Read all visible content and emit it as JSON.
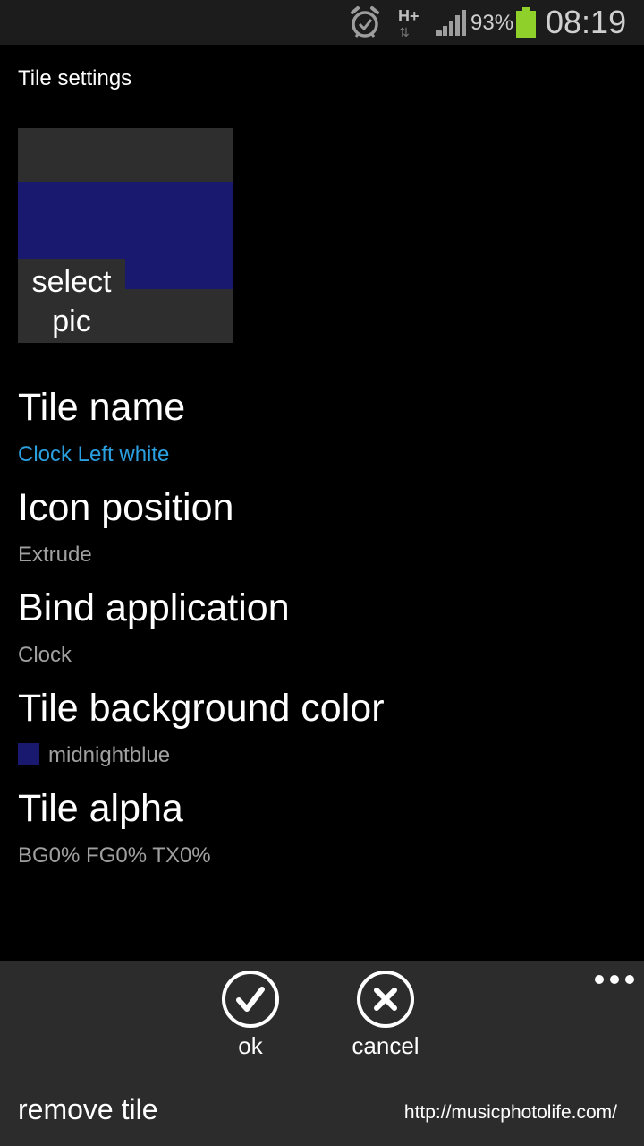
{
  "status_bar": {
    "network_type": "H+",
    "network_arrows": "⇅",
    "battery_percent": "93%",
    "time": "08:19"
  },
  "page": {
    "title": "Tile settings"
  },
  "picture": {
    "select_label_line1": "select",
    "select_label_line2": "pic",
    "band_color": "#191970"
  },
  "settings": {
    "tile_name": {
      "title": "Tile name",
      "value": "Clock Left white"
    },
    "icon_position": {
      "title": "Icon position",
      "value": "Extrude"
    },
    "bind_application": {
      "title": "Bind application",
      "value": "Clock"
    },
    "background_color": {
      "title": "Tile background color",
      "value": "midnightblue",
      "swatch": "#191970"
    },
    "tile_alpha": {
      "title": "Tile alpha",
      "value": "BG0% FG0% TX0%"
    }
  },
  "app_bar": {
    "ok_label": "ok",
    "cancel_label": "cancel",
    "remove_tile_label": "remove tile",
    "watermark": "http://musicphotolife.com/"
  },
  "colors": {
    "accent": "#2aa0e0",
    "battery": "#8fd12a",
    "app_bar": "#2c2c2c"
  },
  "icons": [
    "alarm-icon",
    "signal-icon",
    "battery-icon",
    "check-icon",
    "close-icon",
    "more-icon"
  ]
}
